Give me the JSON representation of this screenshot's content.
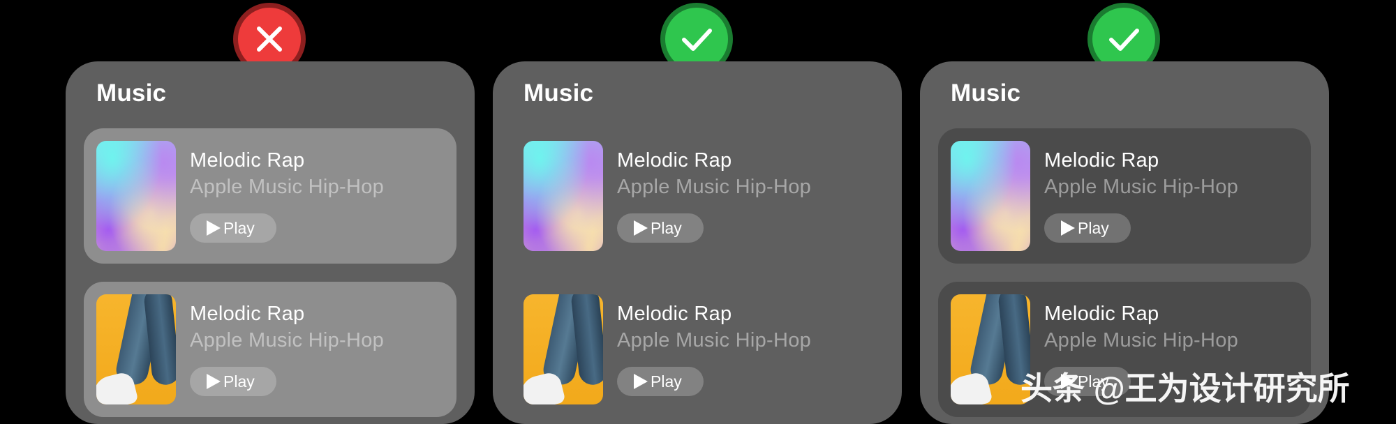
{
  "badges": [
    {
      "type": "cross",
      "icon": "cross-icon",
      "color": "#ee3b3b"
    },
    {
      "type": "check",
      "icon": "check-icon",
      "color": "#2fc64e"
    },
    {
      "type": "check",
      "icon": "check-icon",
      "color": "#2fc64e"
    }
  ],
  "panels": [
    {
      "title": "Music",
      "items": [
        {
          "title": "Melodic Rap",
          "subtitle": "Apple Music Hip-Hop",
          "play_label": "Play",
          "artwork": "gradient-artwork"
        },
        {
          "title": "Melodic Rap",
          "subtitle": "Apple Music Hip-Hop",
          "play_label": "Play",
          "artwork": "legs-photo-artwork"
        }
      ]
    },
    {
      "title": "Music",
      "items": [
        {
          "title": "Melodic Rap",
          "subtitle": "Apple Music Hip-Hop",
          "play_label": "Play",
          "artwork": "gradient-artwork"
        },
        {
          "title": "Melodic Rap",
          "subtitle": "Apple Music Hip-Hop",
          "play_label": "Play",
          "artwork": "legs-photo-artwork"
        }
      ]
    },
    {
      "title": "Music",
      "items": [
        {
          "title": "Melodic Rap",
          "subtitle": "Apple Music Hip-Hop",
          "play_label": "Play",
          "artwork": "gradient-artwork"
        },
        {
          "title": "Melodic Rap",
          "subtitle": "Apple Music Hip-Hop",
          "play_label": "Play",
          "artwork": "legs-photo-artwork"
        }
      ]
    }
  ],
  "watermark": "头条 @王为设计研究所"
}
